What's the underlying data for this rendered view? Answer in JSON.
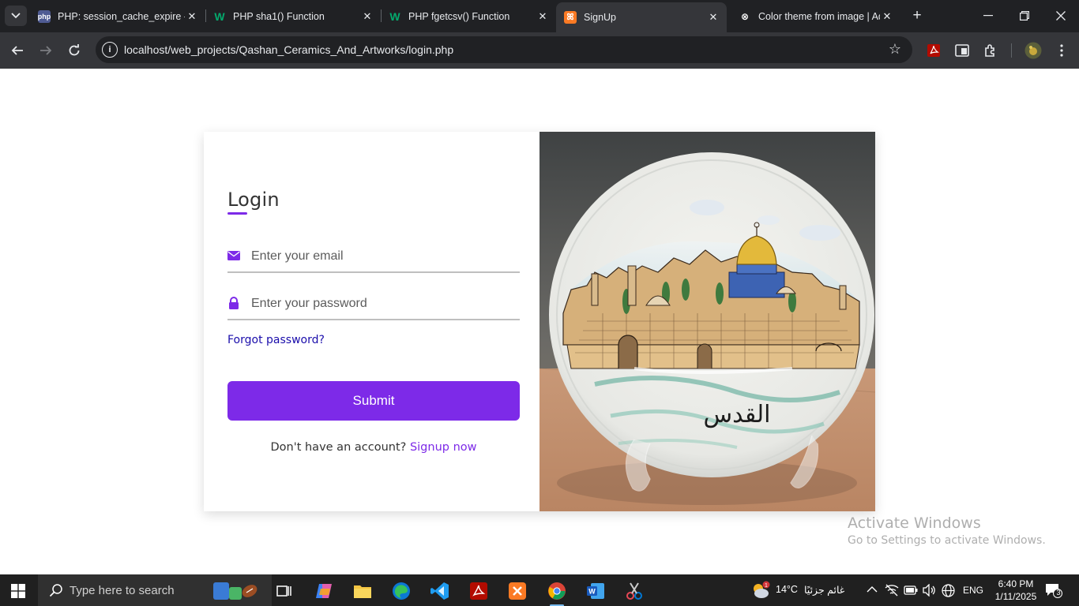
{
  "browser": {
    "tabs": [
      {
        "title": "PHP: session_cache_expire -",
        "favicon": "php",
        "color": "#4f5b93"
      },
      {
        "title": "PHP sha1() Function",
        "favicon": "w3schools",
        "color": "#04aa6d"
      },
      {
        "title": "PHP fgetcsv() Function",
        "favicon": "w3schools",
        "color": "#04aa6d"
      },
      {
        "title": "SignUp",
        "favicon": "xampp",
        "color": "#fb7a24"
      },
      {
        "title": "Color theme from image | Ad",
        "favicon": "adobe-color",
        "color": "#ffffff"
      }
    ],
    "address": "localhost/web_projects/Qashan_Ceramics_And_Artworks/login.php"
  },
  "login": {
    "title": "Login",
    "email_placeholder": "Enter your email",
    "password_placeholder": "Enter your password",
    "forgot": "Forgot password?",
    "submit": "Submit",
    "signup_prompt": "Don't have an account?",
    "signup_link": "Signup now"
  },
  "image": {
    "plate_text": "القدس"
  },
  "watermark": {
    "line1": "Activate Windows",
    "line2": "Go to Settings to activate Windows."
  },
  "taskbar": {
    "search_placeholder": "Type here to search",
    "weather_temp": "14°C",
    "weather_desc": "غائم جزئيًا",
    "language": "ENG",
    "time": "6:40 PM",
    "date": "1/11/2025",
    "notifications": "3"
  },
  "colors": {
    "accent": "#7d2ae8",
    "link": "#1a0dab"
  }
}
